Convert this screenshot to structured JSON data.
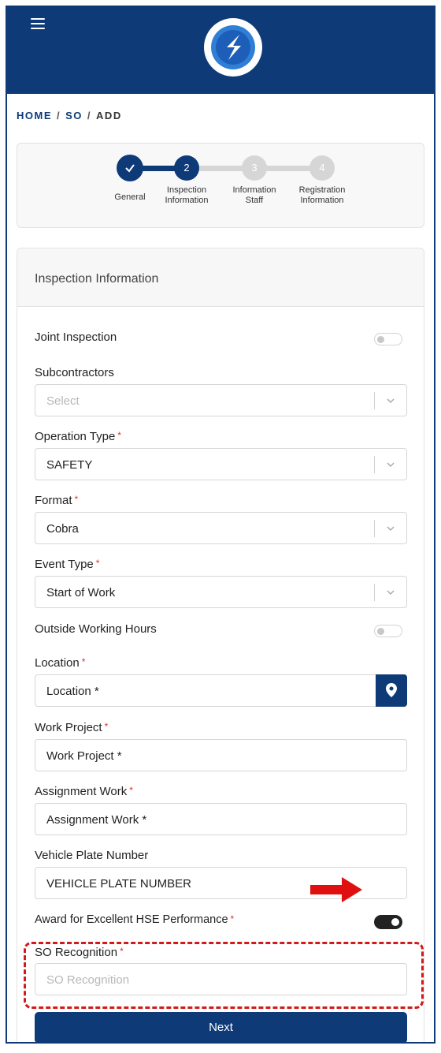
{
  "breadcrumb": {
    "home": "HOME",
    "so": "SO",
    "current": "ADD",
    "separator": "/"
  },
  "stepper": {
    "steps": [
      {
        "number": "✓",
        "label_line1": "General",
        "label_line2": "",
        "state": "done"
      },
      {
        "number": "2",
        "label_line1": "Inspection",
        "label_line2": "Information",
        "state": "active"
      },
      {
        "number": "3",
        "label_line1": "Information",
        "label_line2": "Staff",
        "state": "pending"
      },
      {
        "number": "4",
        "label_line1": "Registration",
        "label_line2": "Information",
        "state": "pending"
      }
    ]
  },
  "form": {
    "section_title": "Inspection Information",
    "required_mark": "*",
    "joint_inspection": {
      "label": "Joint Inspection",
      "checked": false
    },
    "subcontractors": {
      "label": "Subcontractors",
      "placeholder": "Select"
    },
    "operation_type": {
      "label": "Operation Type",
      "value": "SAFETY"
    },
    "format": {
      "label": "Format",
      "value": "Cobra"
    },
    "event_type": {
      "label": "Event Type",
      "value": "Start of Work"
    },
    "outside_working_hours": {
      "label": "Outside Working Hours",
      "checked": false
    },
    "location": {
      "label": "Location",
      "value": "Location *"
    },
    "work_project": {
      "label": "Work Project",
      "value": "Work Project *"
    },
    "assignment_work": {
      "label": "Assignment Work",
      "value": "Assignment Work *"
    },
    "vehicle_plate": {
      "label": "Vehicle Plate Number",
      "value": "VEHICLE PLATE NUMBER"
    },
    "award": {
      "label": "Award for Excellent HSE Performance",
      "checked": true
    },
    "so_recognition": {
      "label": "SO Recognition",
      "placeholder": "SO Recognition"
    },
    "next_label": "Next"
  },
  "icons": {
    "menu": "hamburger-menu-icon",
    "logo": "app-logo",
    "location": "map-pin-icon",
    "dropdown": "chevron-down-icon",
    "check": "checkmark-icon"
  },
  "colors": {
    "primary": "#0e3a78",
    "pending_step": "#d6d6d6",
    "required": "#e03131",
    "annotation": "#d11a1a"
  }
}
